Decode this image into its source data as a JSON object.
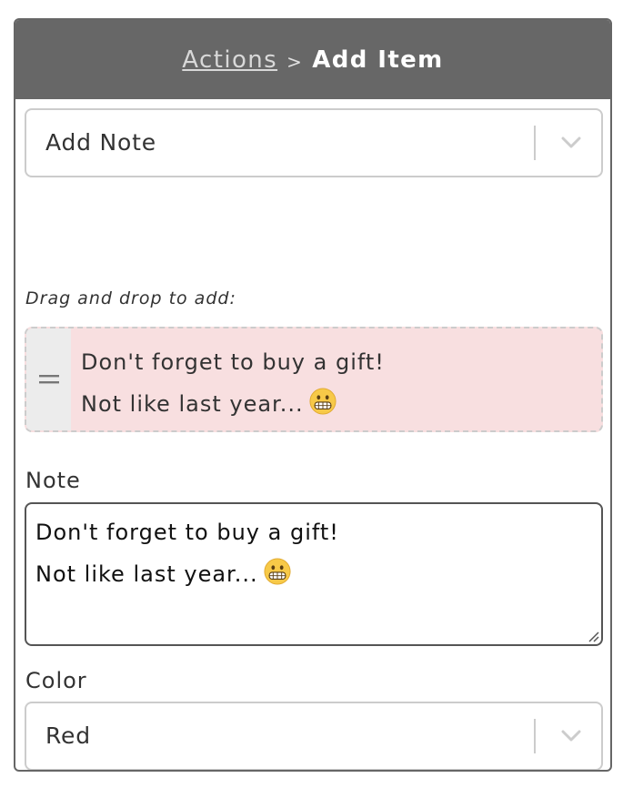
{
  "header": {
    "breadcrumb_parent": "Actions",
    "breadcrumb_separator": ">",
    "title": "Add Item"
  },
  "item_type_select": {
    "value": "Add Note",
    "icon": "chevron-down-icon"
  },
  "drag_hint": "Drag and drop to add:",
  "preview_item": {
    "handle_icon": "drag-handle-icon",
    "line1": "Don't forget to buy a gift!",
    "line2": "Not like last year...",
    "emoji": "grimacing-face-emoji",
    "background_color": "#f8dfe0"
  },
  "note_field": {
    "label": "Note",
    "line1": "Don't forget to buy a gift!",
    "line2": "Not like last year...",
    "emoji": "grimacing-face-emoji"
  },
  "color_field": {
    "label": "Color",
    "value": "Red",
    "icon": "chevron-down-icon"
  },
  "colors": {
    "header_bg": "#676767",
    "border": "#cccccc",
    "text": "#333333"
  }
}
